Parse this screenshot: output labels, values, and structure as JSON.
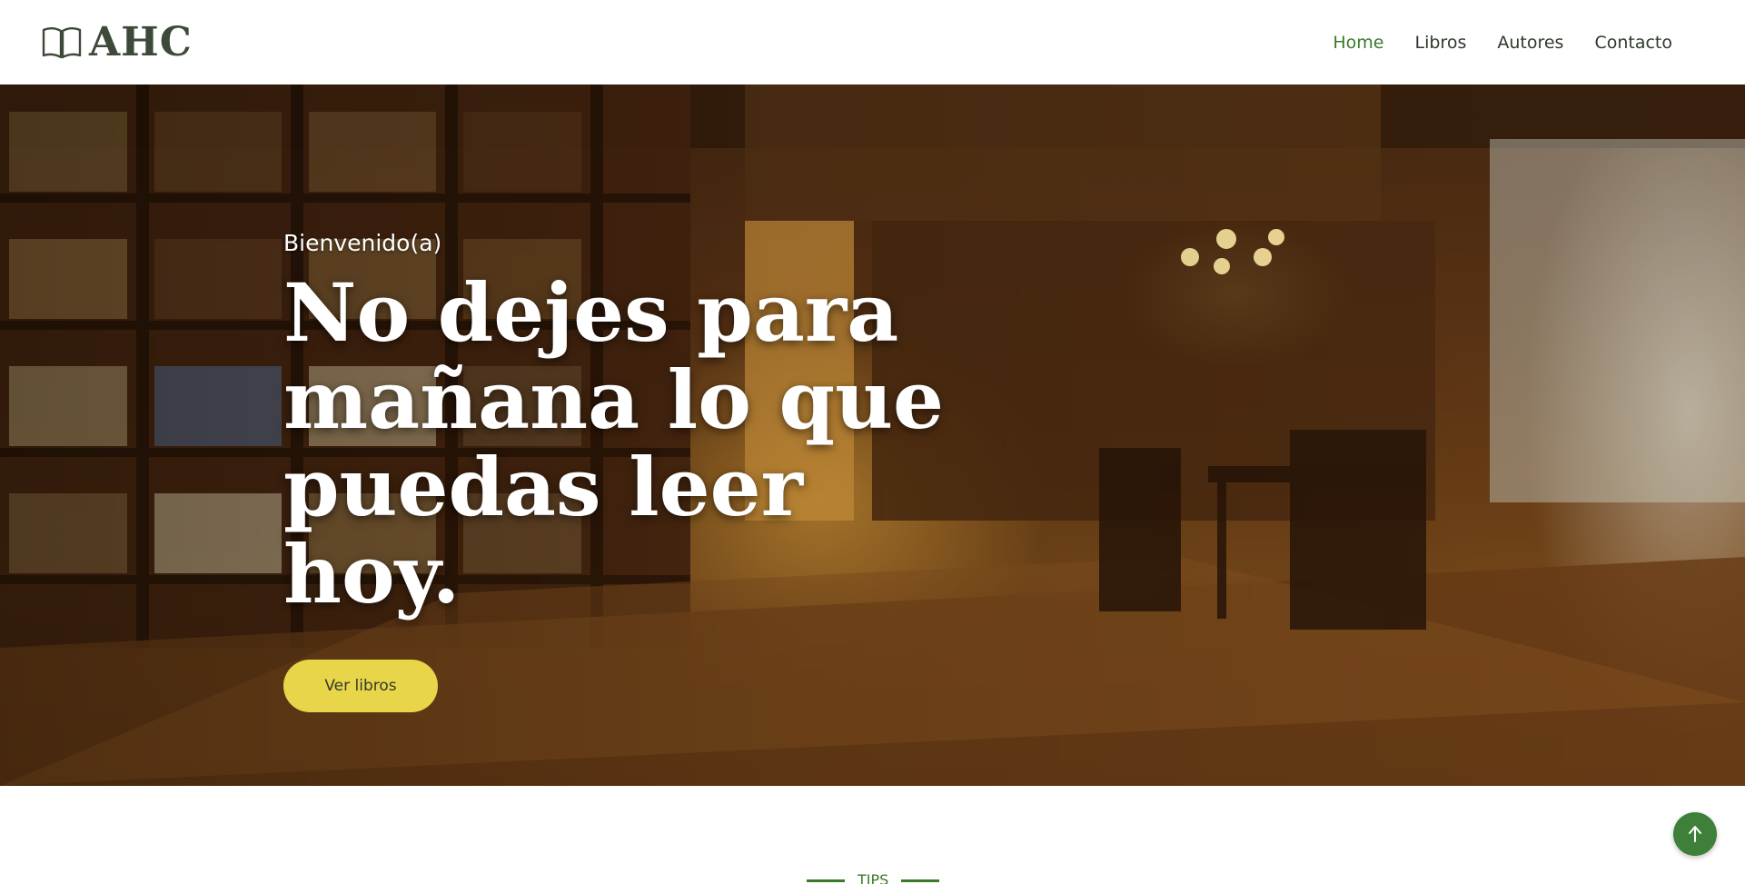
{
  "brand": {
    "name": "AHC",
    "icon": "book-open-icon"
  },
  "nav": {
    "items": [
      {
        "label": "Home",
        "active": true
      },
      {
        "label": "Libros",
        "active": false
      },
      {
        "label": "Autores",
        "active": false
      },
      {
        "label": "Contacto",
        "active": false
      }
    ]
  },
  "hero": {
    "eyebrow": "Bienvenido(a)",
    "headline_line1": "No dejes para",
    "headline_line2": "mañana lo que",
    "headline_line3": "puedas leer hoy.",
    "cta_label": "Ver libros",
    "background": "library-interior-photo"
  },
  "section": {
    "label": "TIPS"
  },
  "back_to_top": {
    "icon": "arrow-up-icon"
  },
  "colors": {
    "accent_green": "#3b7a2a",
    "cta_yellow": "#e9d54a",
    "to_top_green": "#3e7f3a",
    "brand_text": "#3d4a3a"
  }
}
